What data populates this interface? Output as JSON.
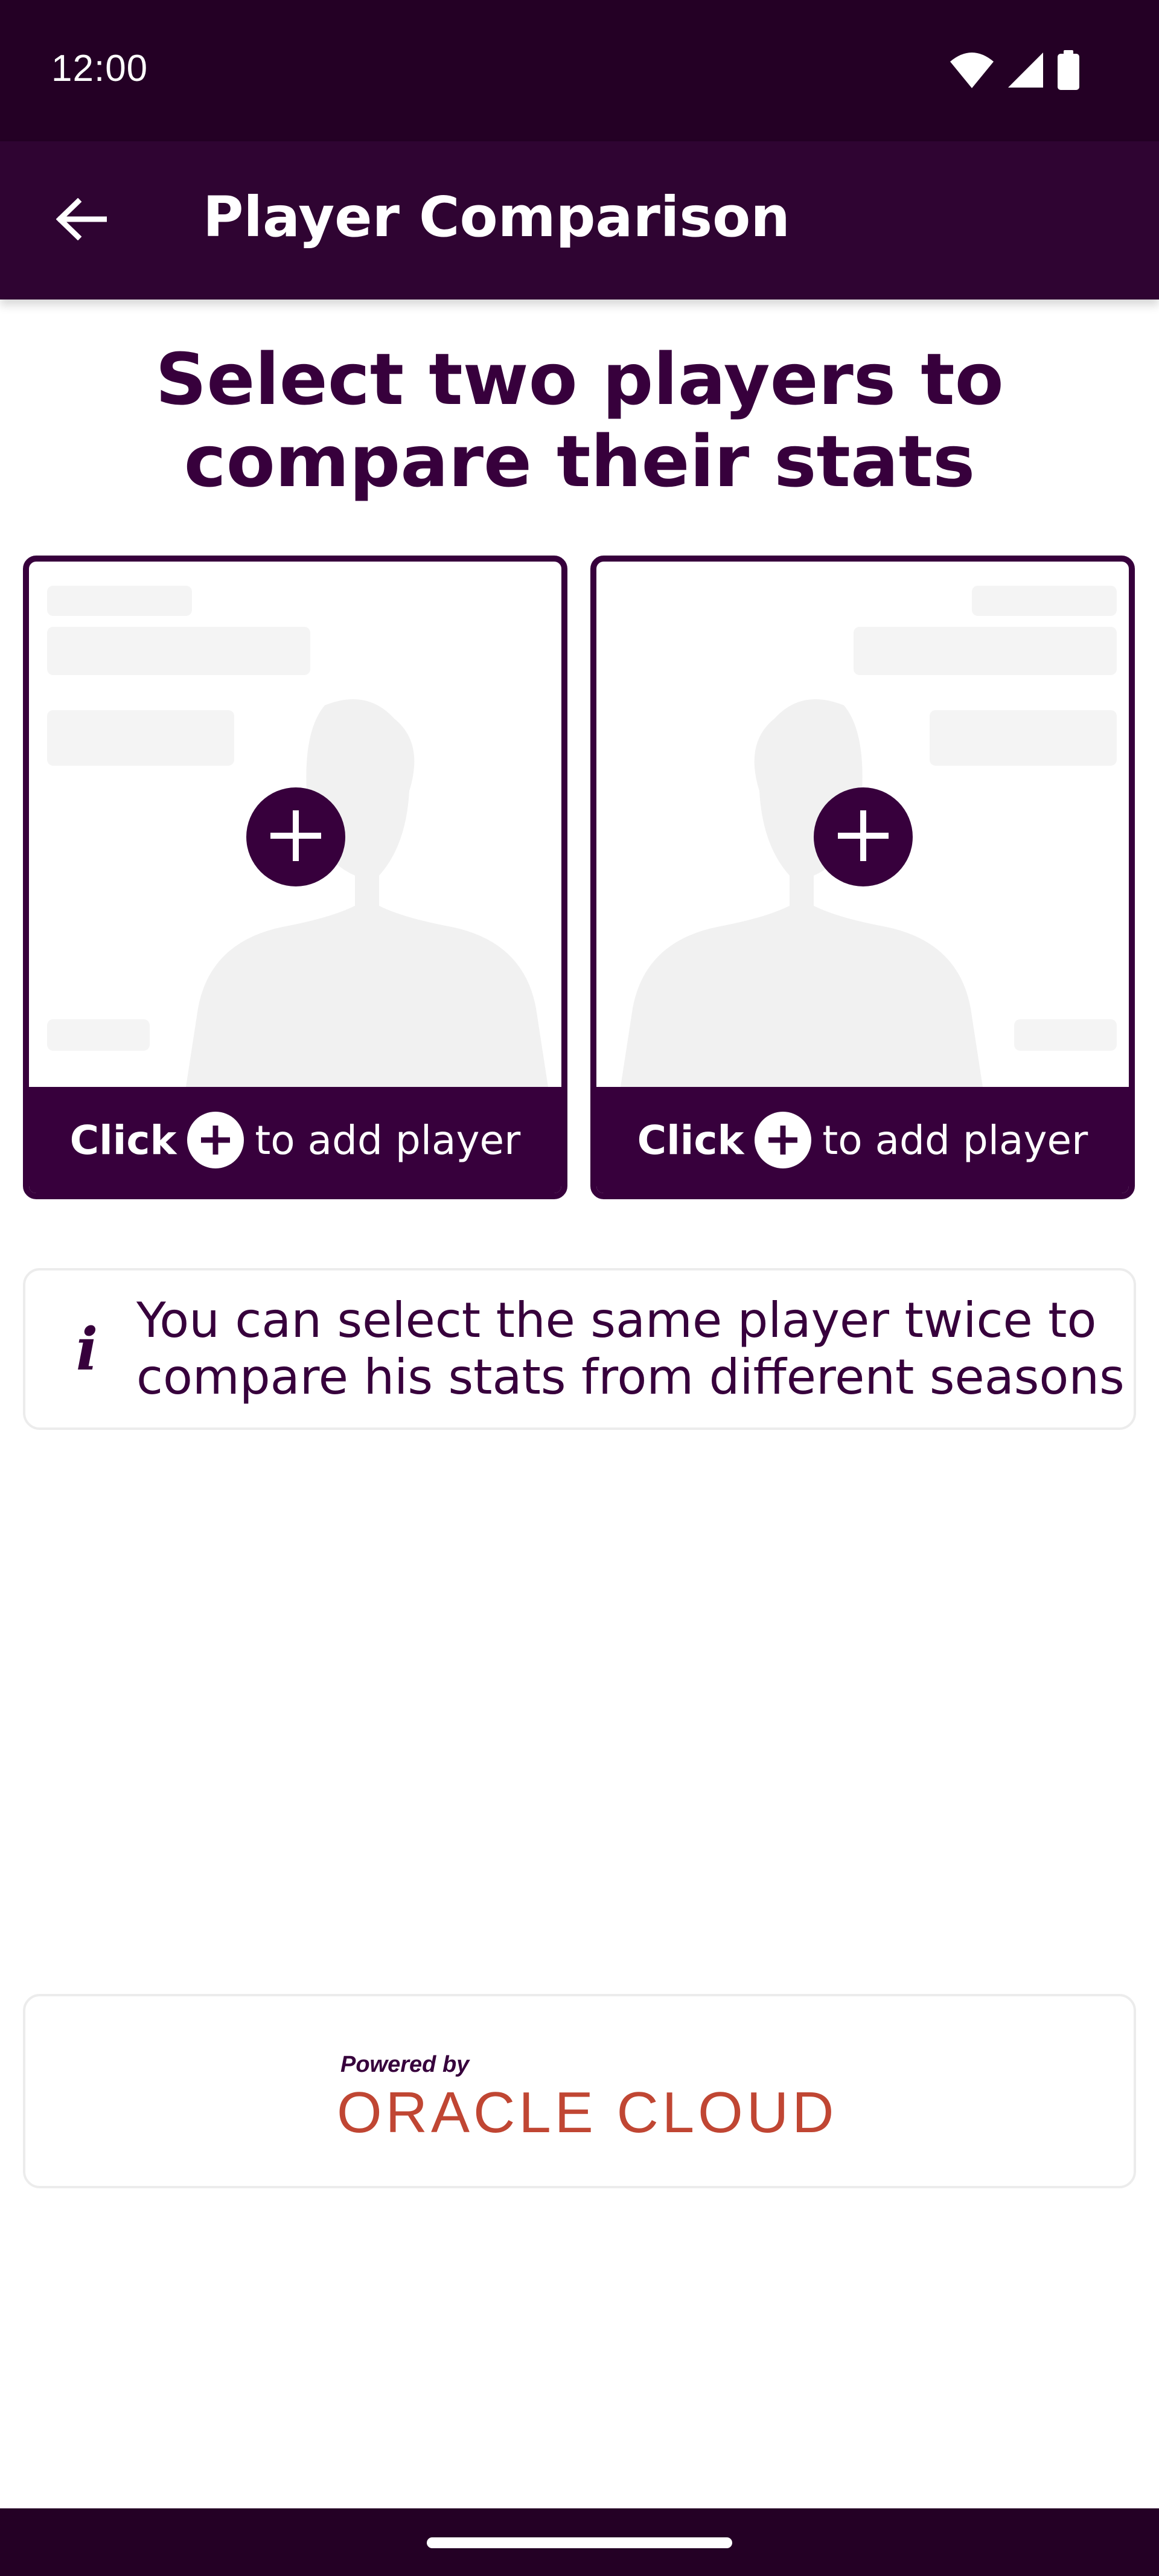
{
  "status_bar": {
    "time": "12:00",
    "icons": [
      "wifi-icon",
      "signal-icon",
      "battery-icon"
    ]
  },
  "app_bar": {
    "title": "Player Comparison",
    "back_icon": "arrow-left-icon"
  },
  "heading": {
    "line1": "Select two players to",
    "line2": "compare their stats"
  },
  "player_slots": [
    {
      "footer_click": "Click",
      "footer_text": "to add player",
      "add_icon": "plus-icon"
    },
    {
      "footer_click": "Click",
      "footer_text": "to add player",
      "add_icon": "plus-icon"
    }
  ],
  "info": {
    "icon": "info-icon",
    "icon_glyph": "i",
    "line1": "You can select the same player twice to",
    "line2": "compare his stats from different seasons"
  },
  "sponsor": {
    "powered_by": "Powered by",
    "name": "ORACLE CLOUD"
  },
  "colors": {
    "brand_purple": "#37003c",
    "status_bar": "#240025",
    "app_bar": "#2f0432",
    "sponsor_red": "#c04633",
    "skeleton": "#f4f4f4"
  }
}
